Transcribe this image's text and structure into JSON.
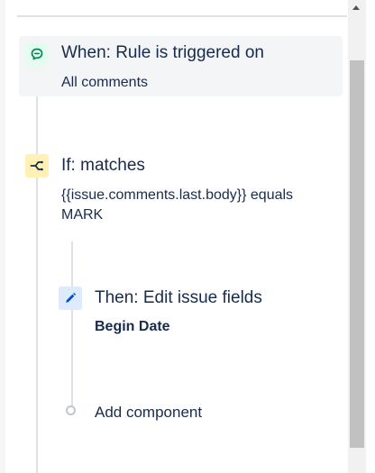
{
  "rule": {
    "trigger": {
      "title": "When: Rule is triggered on",
      "detail": "All comments",
      "icon": "comment-icon"
    },
    "condition": {
      "title": "If: matches",
      "detail": "{{issue.comments.last.body}} equals MARK",
      "icon": "branch-icon"
    },
    "action": {
      "title": "Then: Edit issue fields",
      "detail": "Begin Date",
      "icon": "pencil-icon"
    },
    "add_component_label": "Add component"
  },
  "colors": {
    "trigger_icon_bg": "#e3fcef",
    "trigger_icon_fg": "#00875a",
    "condition_icon_bg": "#fff0b3",
    "condition_icon_fg": "#172b4d",
    "action_icon_bg": "#deebff",
    "action_icon_fg": "#0052cc"
  }
}
